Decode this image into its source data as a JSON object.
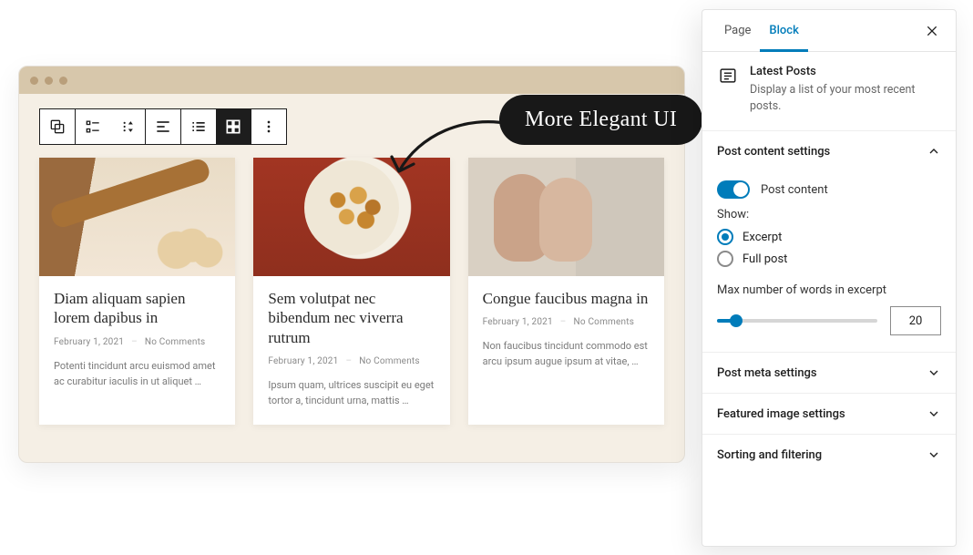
{
  "callout": "More Elegant UI",
  "posts": [
    {
      "title": "Diam aliquam sapien lorem dapibus in",
      "date": "February 1, 2021",
      "comments": "No Comments",
      "excerpt": "Potenti tincidunt arcu euismod amet ac curabitur iaculis in ut aliquet …"
    },
    {
      "title": "Sem volutpat nec bibendum nec viverra rutrum",
      "date": "February 1, 2021",
      "comments": "No Comments",
      "excerpt": "Ipsum quam, ultrices suscipit eu eget tortor a, tincidunt urna, mattis …"
    },
    {
      "title": "Congue faucibus magna in",
      "date": "February 1, 2021",
      "comments": "No Comments",
      "excerpt": "Non faucibus tincidunt commodo est arcu ipsum augue ipsum at vitae, …"
    }
  ],
  "sidebar": {
    "tabs": {
      "page": "Page",
      "block": "Block"
    },
    "block": {
      "name": "Latest Posts",
      "desc": "Display a list of your most recent posts."
    },
    "panels": {
      "content": {
        "title": "Post content settings",
        "toggle_label": "Post content",
        "show_label": "Show:",
        "opt_excerpt": "Excerpt",
        "opt_full": "Full post",
        "max_label": "Max number of words in excerpt",
        "max_value": "20"
      },
      "meta": "Post meta settings",
      "featured": "Featured image settings",
      "sort": "Sorting and filtering"
    }
  }
}
